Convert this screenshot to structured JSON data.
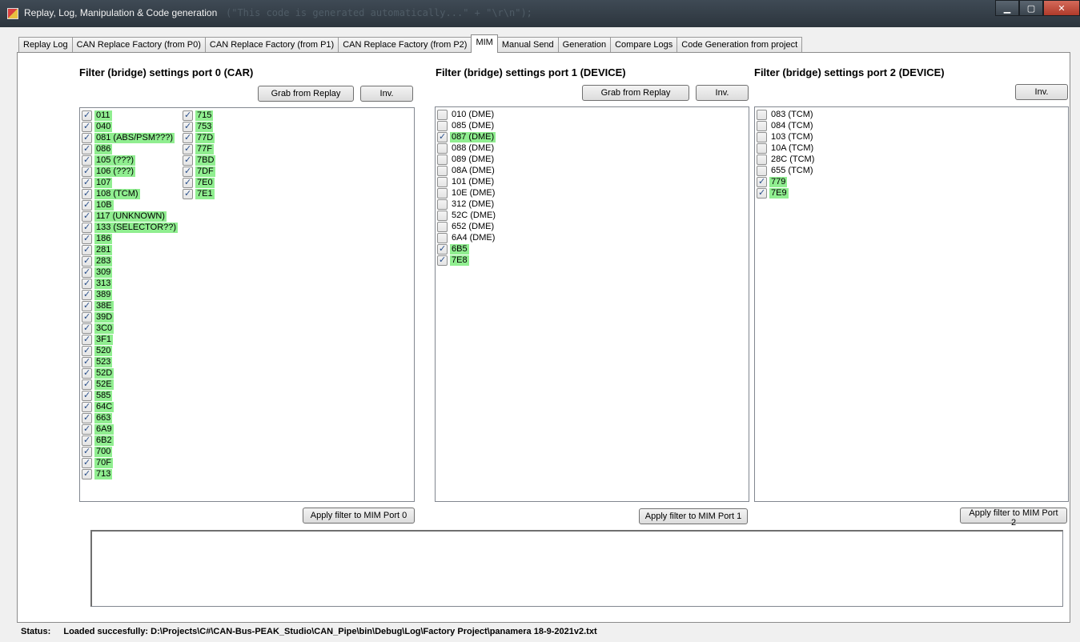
{
  "window": {
    "title": "Replay, Log, Manipulation & Code generation",
    "ghost_text": "(\"This code is generated automatically...\" + \"\\r\\n\");"
  },
  "tabs": [
    {
      "label": "Replay Log"
    },
    {
      "label": "CAN Replace Factory (from P0)"
    },
    {
      "label": "CAN Replace Factory (from P1)"
    },
    {
      "label": "CAN Replace Factory (from P2)"
    },
    {
      "label": "MIM"
    },
    {
      "label": "Manual Send"
    },
    {
      "label": "Generation"
    },
    {
      "label": "Compare Logs"
    },
    {
      "label": "Code Generation from project"
    }
  ],
  "active_tab": "MIM",
  "highlight_color": "#90ee90",
  "port0": {
    "heading": "Filter (bridge) settings port 0 (CAR)",
    "grab_label": "Grab from Replay",
    "inv_label": "Inv.",
    "apply_label": "Apply filter to MIM Port 0",
    "columns": [
      [
        {
          "text": "011",
          "checked": true
        },
        {
          "text": "040",
          "checked": true
        },
        {
          "text": "081 (ABS/PSM???)",
          "checked": true
        },
        {
          "text": "086",
          "checked": true
        },
        {
          "text": "105 (???)",
          "checked": true
        },
        {
          "text": "106 (???)",
          "checked": true
        },
        {
          "text": "107",
          "checked": true
        },
        {
          "text": "108 (TCM)",
          "checked": true
        },
        {
          "text": "10B",
          "checked": true
        },
        {
          "text": "117 (UNKNOWN)",
          "checked": true
        },
        {
          "text": "133 (SELECTOR??)",
          "checked": true
        },
        {
          "text": "186",
          "checked": true
        },
        {
          "text": "281",
          "checked": true
        },
        {
          "text": "283",
          "checked": true
        },
        {
          "text": "309",
          "checked": true
        },
        {
          "text": "313",
          "checked": true
        },
        {
          "text": "389",
          "checked": true
        },
        {
          "text": "38E",
          "checked": true
        },
        {
          "text": "39D",
          "checked": true
        },
        {
          "text": "3C0",
          "checked": true
        },
        {
          "text": "3F1",
          "checked": true
        },
        {
          "text": "520",
          "checked": true
        },
        {
          "text": "523",
          "checked": true
        },
        {
          "text": "52D",
          "checked": true
        },
        {
          "text": "52E",
          "checked": true
        },
        {
          "text": "585",
          "checked": true
        },
        {
          "text": "64C",
          "checked": true
        },
        {
          "text": "663",
          "checked": true
        },
        {
          "text": "6A9",
          "checked": true
        },
        {
          "text": "6B2",
          "checked": true
        },
        {
          "text": "700",
          "checked": true
        },
        {
          "text": "70F",
          "checked": true
        },
        {
          "text": "713",
          "checked": true
        }
      ],
      [
        {
          "text": "715",
          "checked": true
        },
        {
          "text": "753",
          "checked": true
        },
        {
          "text": "77D",
          "checked": true
        },
        {
          "text": "77F",
          "checked": true
        },
        {
          "text": "7BD",
          "checked": true
        },
        {
          "text": "7DF",
          "checked": true
        },
        {
          "text": "7E0",
          "checked": true
        },
        {
          "text": "7E1",
          "checked": true
        }
      ]
    ]
  },
  "port1": {
    "heading": "Filter (bridge) settings port 1 (DEVICE)",
    "grab_label": "Grab from Replay",
    "inv_label": "Inv.",
    "apply_label": "Apply filter to MIM Port 1",
    "columns": [
      [
        {
          "text": "010 (DME)",
          "checked": false
        },
        {
          "text": "085 (DME)",
          "checked": false
        },
        {
          "text": "087 (DME)",
          "checked": true
        },
        {
          "text": "088 (DME)",
          "checked": false
        },
        {
          "text": "089 (DME)",
          "checked": false
        },
        {
          "text": "08A (DME)",
          "checked": false
        },
        {
          "text": "101 (DME)",
          "checked": false
        },
        {
          "text": "10E (DME)",
          "checked": false
        },
        {
          "text": "312 (DME)",
          "checked": false
        },
        {
          "text": "52C (DME)",
          "checked": false
        },
        {
          "text": "652 (DME)",
          "checked": false
        },
        {
          "text": "6A4 (DME)",
          "checked": false
        },
        {
          "text": "6B5",
          "checked": true
        },
        {
          "text": "7E8",
          "checked": true
        }
      ]
    ]
  },
  "port2": {
    "heading": "Filter (bridge) settings port 2 (DEVICE)",
    "inv_label": "Inv.",
    "apply_label": "Apply filter to MIM Port 2",
    "columns": [
      [
        {
          "text": "083 (TCM)",
          "checked": false
        },
        {
          "text": "084 (TCM)",
          "checked": false
        },
        {
          "text": "103 (TCM)",
          "checked": false
        },
        {
          "text": "10A (TCM)",
          "checked": false
        },
        {
          "text": "28C (TCM)",
          "checked": false
        },
        {
          "text": "655 (TCM)",
          "checked": false
        },
        {
          "text": "779",
          "checked": true
        },
        {
          "text": "7E9",
          "checked": true
        }
      ]
    ]
  },
  "status": {
    "label": "Status:",
    "value": "Loaded succesfully: D:\\Projects\\C#\\CAN-Bus-PEAK_Studio\\CAN_Pipe\\bin\\Debug\\Log\\Factory Project\\panamera 18-9-2021v2.txt"
  },
  "icons": {
    "app": "app-icon",
    "minimize": "minimize-icon",
    "maximize": "maximize-icon",
    "close": "close-icon",
    "checkbox_checked": "checkmark-icon"
  }
}
